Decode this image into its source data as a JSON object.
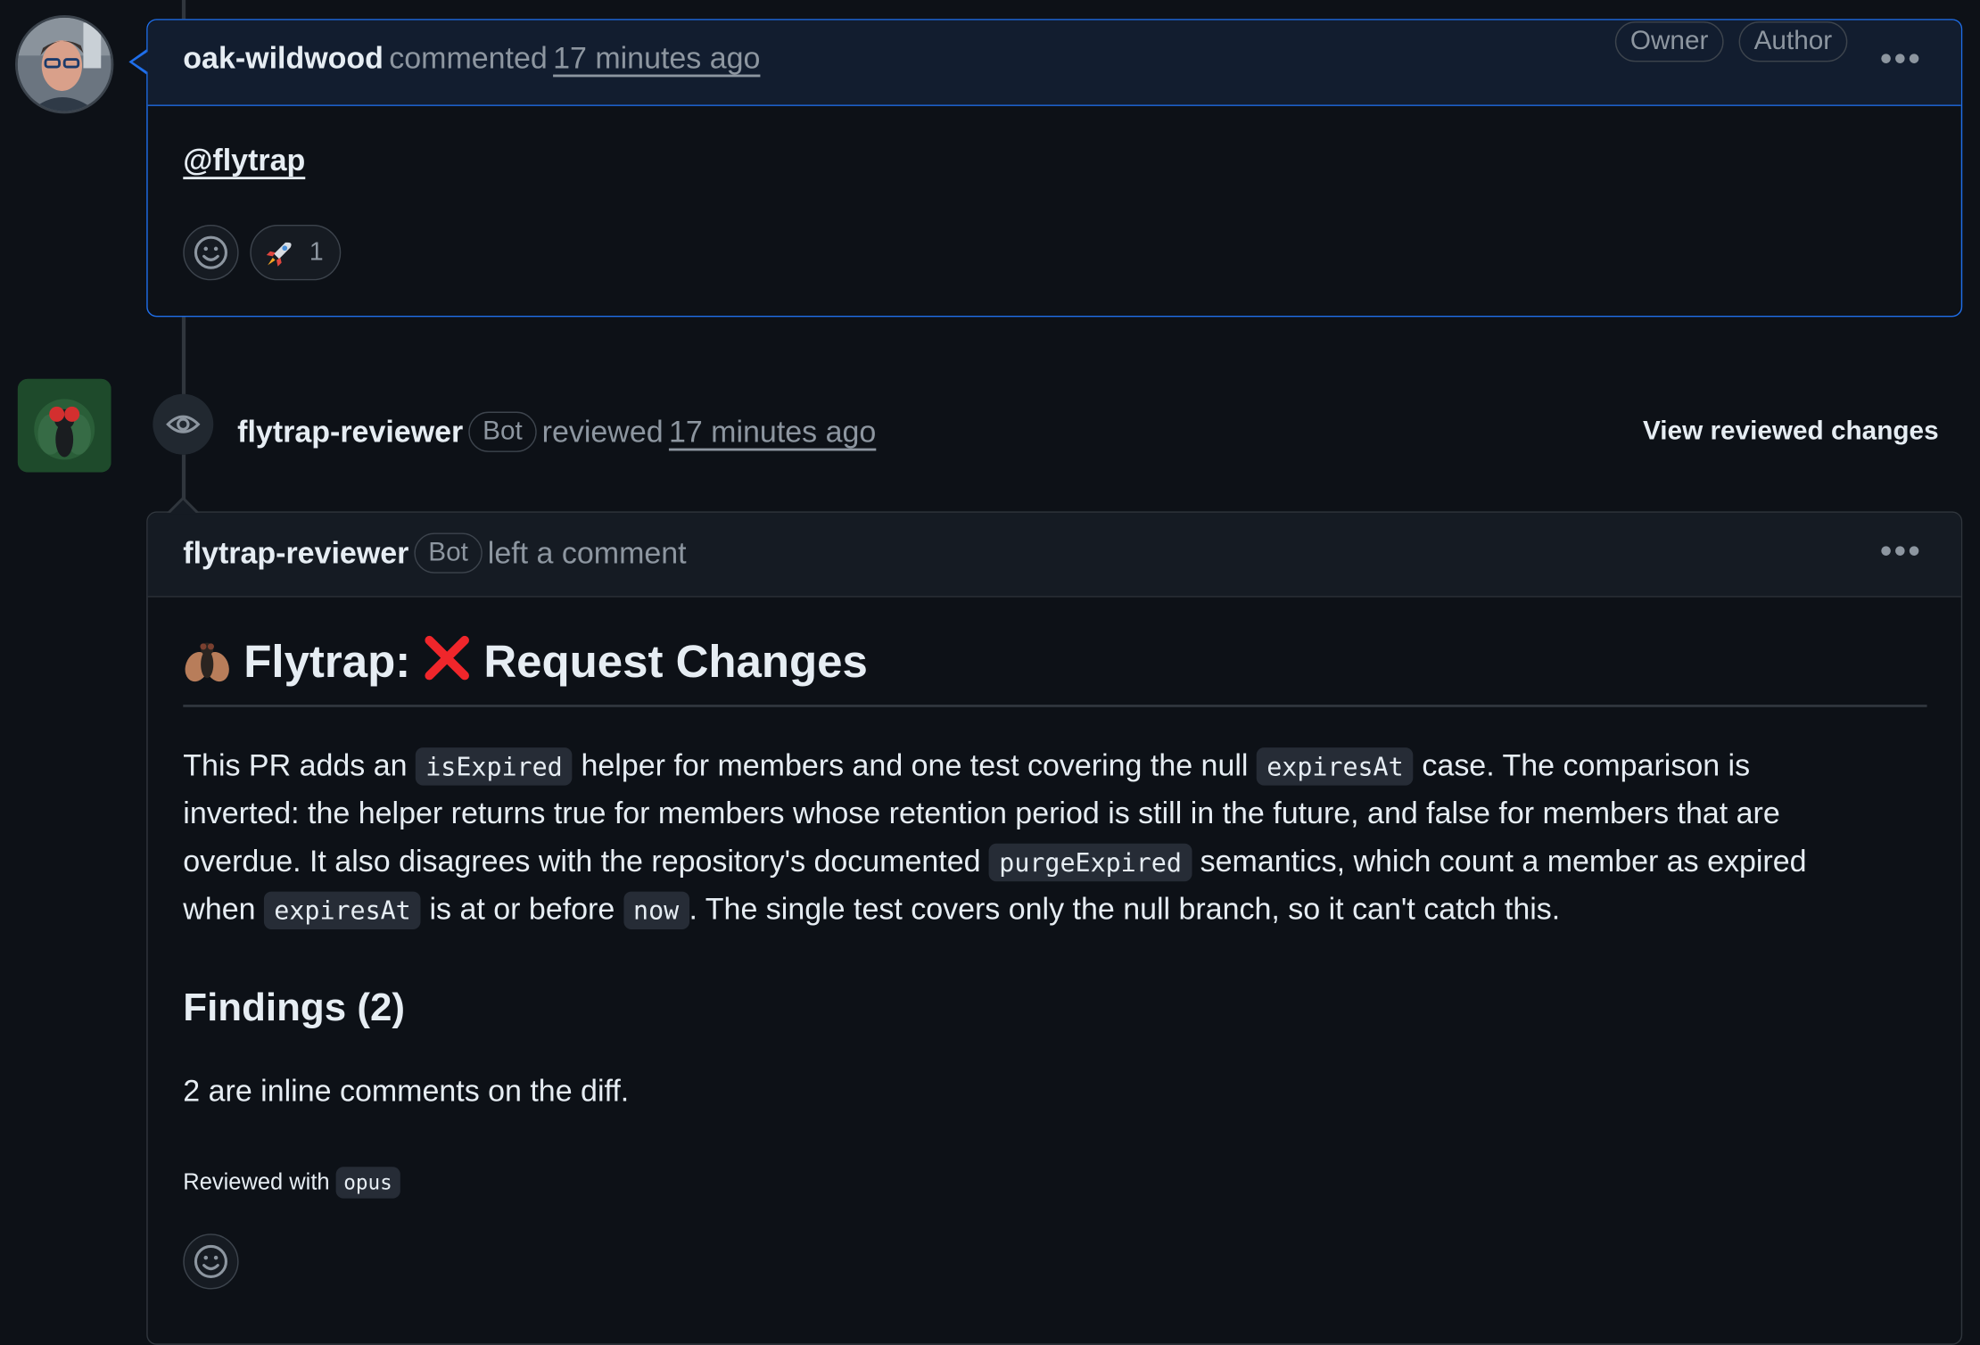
{
  "comment": {
    "author": "oak-wildwood",
    "action": "commented",
    "time": "17 minutes ago",
    "labels": [
      "Owner",
      "Author"
    ],
    "body_mention": "@flytrap",
    "reactions": [
      {
        "emoji": "🚀",
        "count": "1"
      }
    ]
  },
  "review_event": {
    "reviewer": "flytrap-reviewer",
    "bot_label": "Bot",
    "action": "reviewed",
    "time": "17 minutes ago",
    "view_changes": "View reviewed changes"
  },
  "review_comment": {
    "author": "flytrap-reviewer",
    "bot_label": "Bot",
    "action": "left a comment",
    "title_prefix": "Flytrap:",
    "title_status": "Request Changes",
    "summary": {
      "line1_a": "This PR adds an",
      "code1": "isExpired",
      "line1_b": "helper for members and one test covering the null",
      "code2": "expiresAt",
      "line1_c": "case. The comparison is",
      "line2": "inverted: the helper returns true for members whose retention period is still in the future, and false for members that are",
      "line3_a": "overdue. It also disagrees with the repository's documented",
      "code3": "purgeExpired",
      "line3_b": "semantics, which count a member as expired",
      "line4_a": "when",
      "code4": "expiresAt",
      "line4_b": "is at or before",
      "code5": "now",
      "line4_c": ". The single test covers only the null branch, so it can't catch this."
    },
    "findings_heading": "Findings (2)",
    "findings_text": "2 are inline comments on the diff.",
    "reviewed_with_label": "Reviewed with",
    "model": "opus"
  },
  "icons": [
    "smiley-icon",
    "eye-icon",
    "kebab-icon",
    "fly-icon",
    "cross-mark-icon",
    "rocket-icon"
  ],
  "colors": {
    "background": "#0d1117",
    "accent_border": "#1f6feb",
    "muted_text": "#8d96a0",
    "cross_red": "#f85149"
  }
}
